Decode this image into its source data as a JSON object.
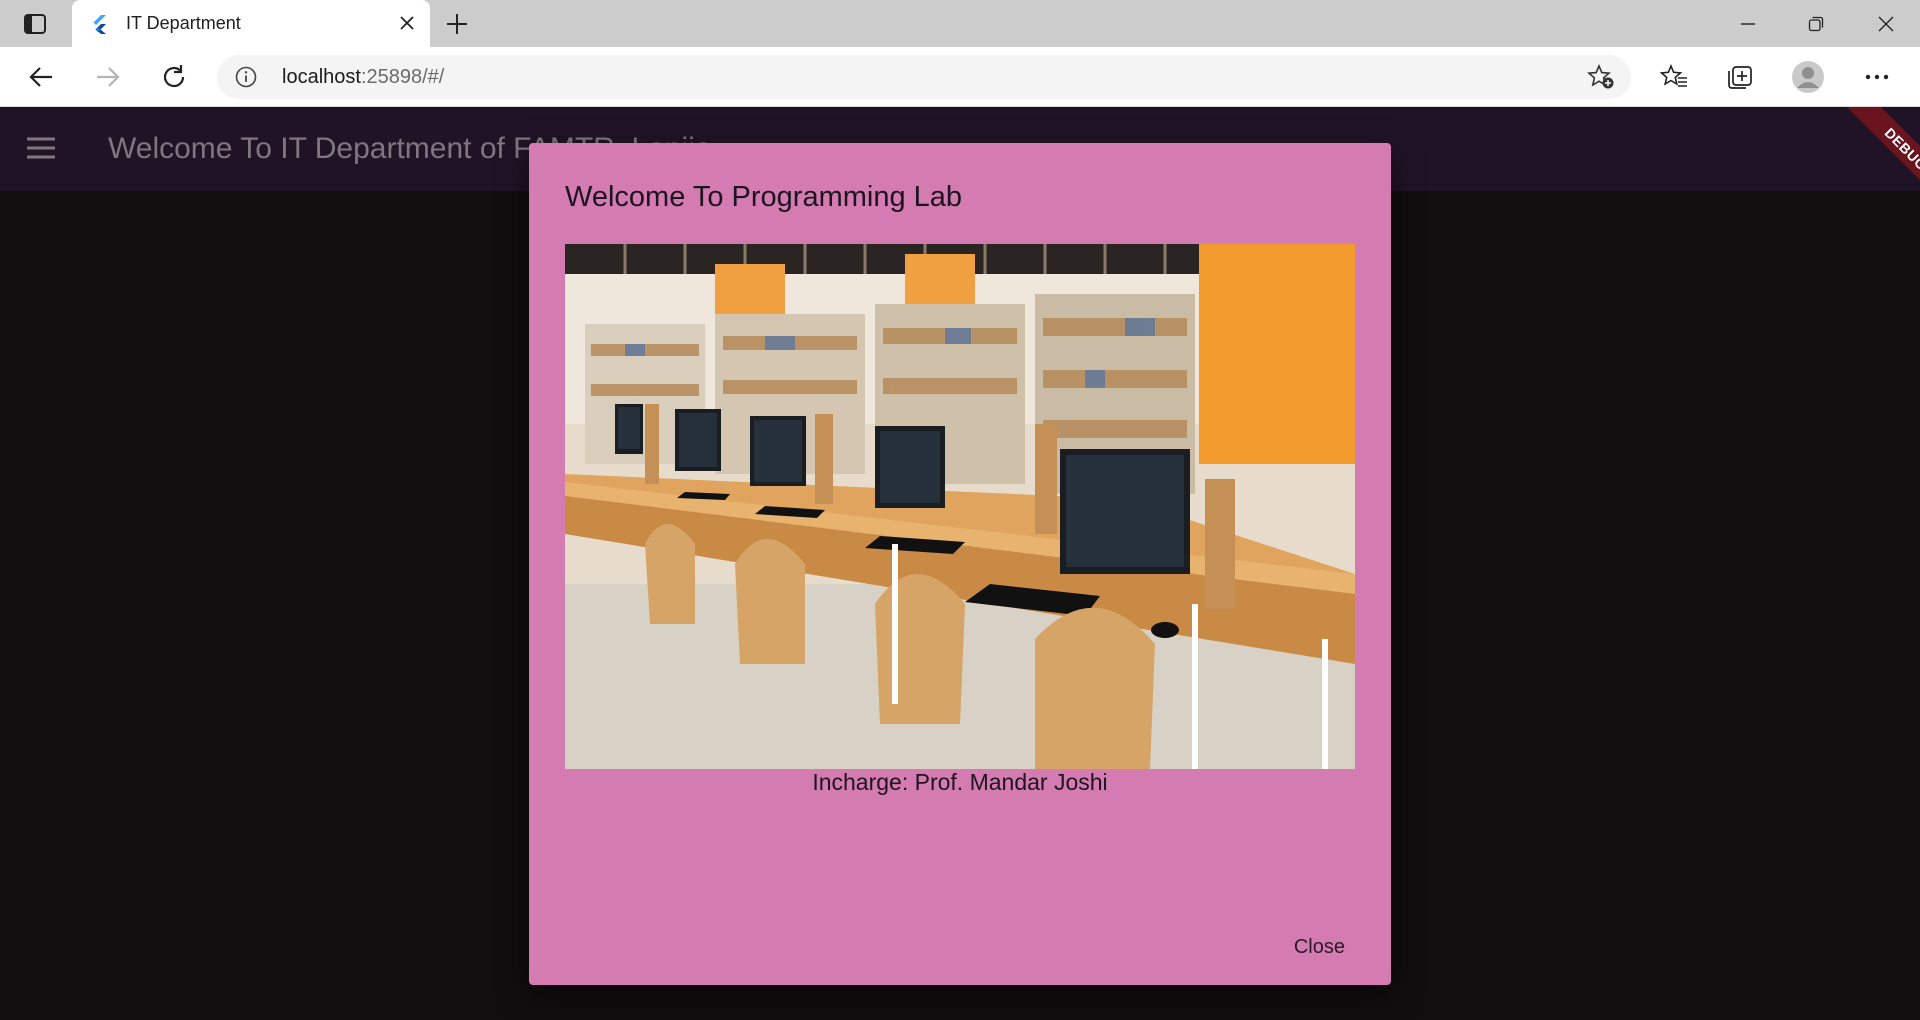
{
  "browser": {
    "tab_title": "IT Department",
    "url_host": "localhost",
    "url_rest": ":25898/#/",
    "icons": [
      "tab-actions-icon",
      "flutter-icon",
      "close-icon",
      "plus-icon",
      "minimize-icon",
      "restore-icon",
      "window-close-icon",
      "back-icon",
      "forward-icon",
      "refresh-icon",
      "info-icon",
      "add-favorite-icon",
      "favorites-icon",
      "collections-icon",
      "profile-icon",
      "more-icon"
    ]
  },
  "app": {
    "title": "Welcome To IT Department of FAMTR, Lanjja",
    "debug_label": "DEBUG",
    "colors": {
      "app_bar": "#211326",
      "background": "#120d0e",
      "dialog": "#d47cb1",
      "debug": "#6a1420"
    }
  },
  "dialog": {
    "title": "Welcome To Programming Lab",
    "caption": "Incharge: Prof. Mandar Joshi",
    "close_label": "Close"
  }
}
